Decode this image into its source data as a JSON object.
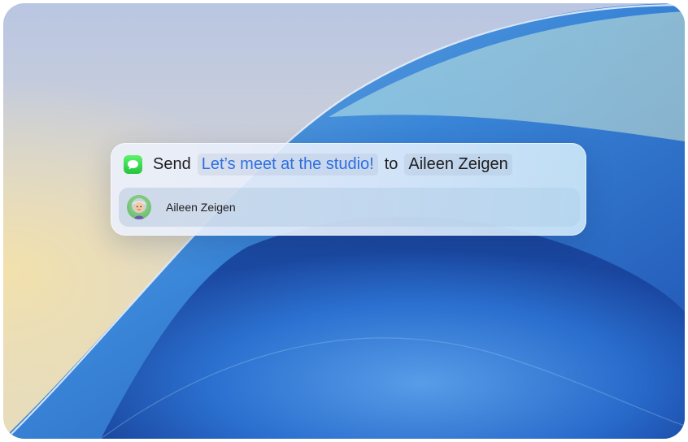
{
  "spotlight": {
    "app_icon": "messages-icon",
    "verb": "Send",
    "message": "Let’s meet at the studio!",
    "preposition": "to",
    "recipient": "Aileen Zeigen"
  },
  "result": {
    "avatar_icon": "memoji-avatar",
    "name": "Aileen Zeigen"
  },
  "colors": {
    "message_token_text": "#2f6fe0",
    "messages_icon": "#34c759"
  }
}
